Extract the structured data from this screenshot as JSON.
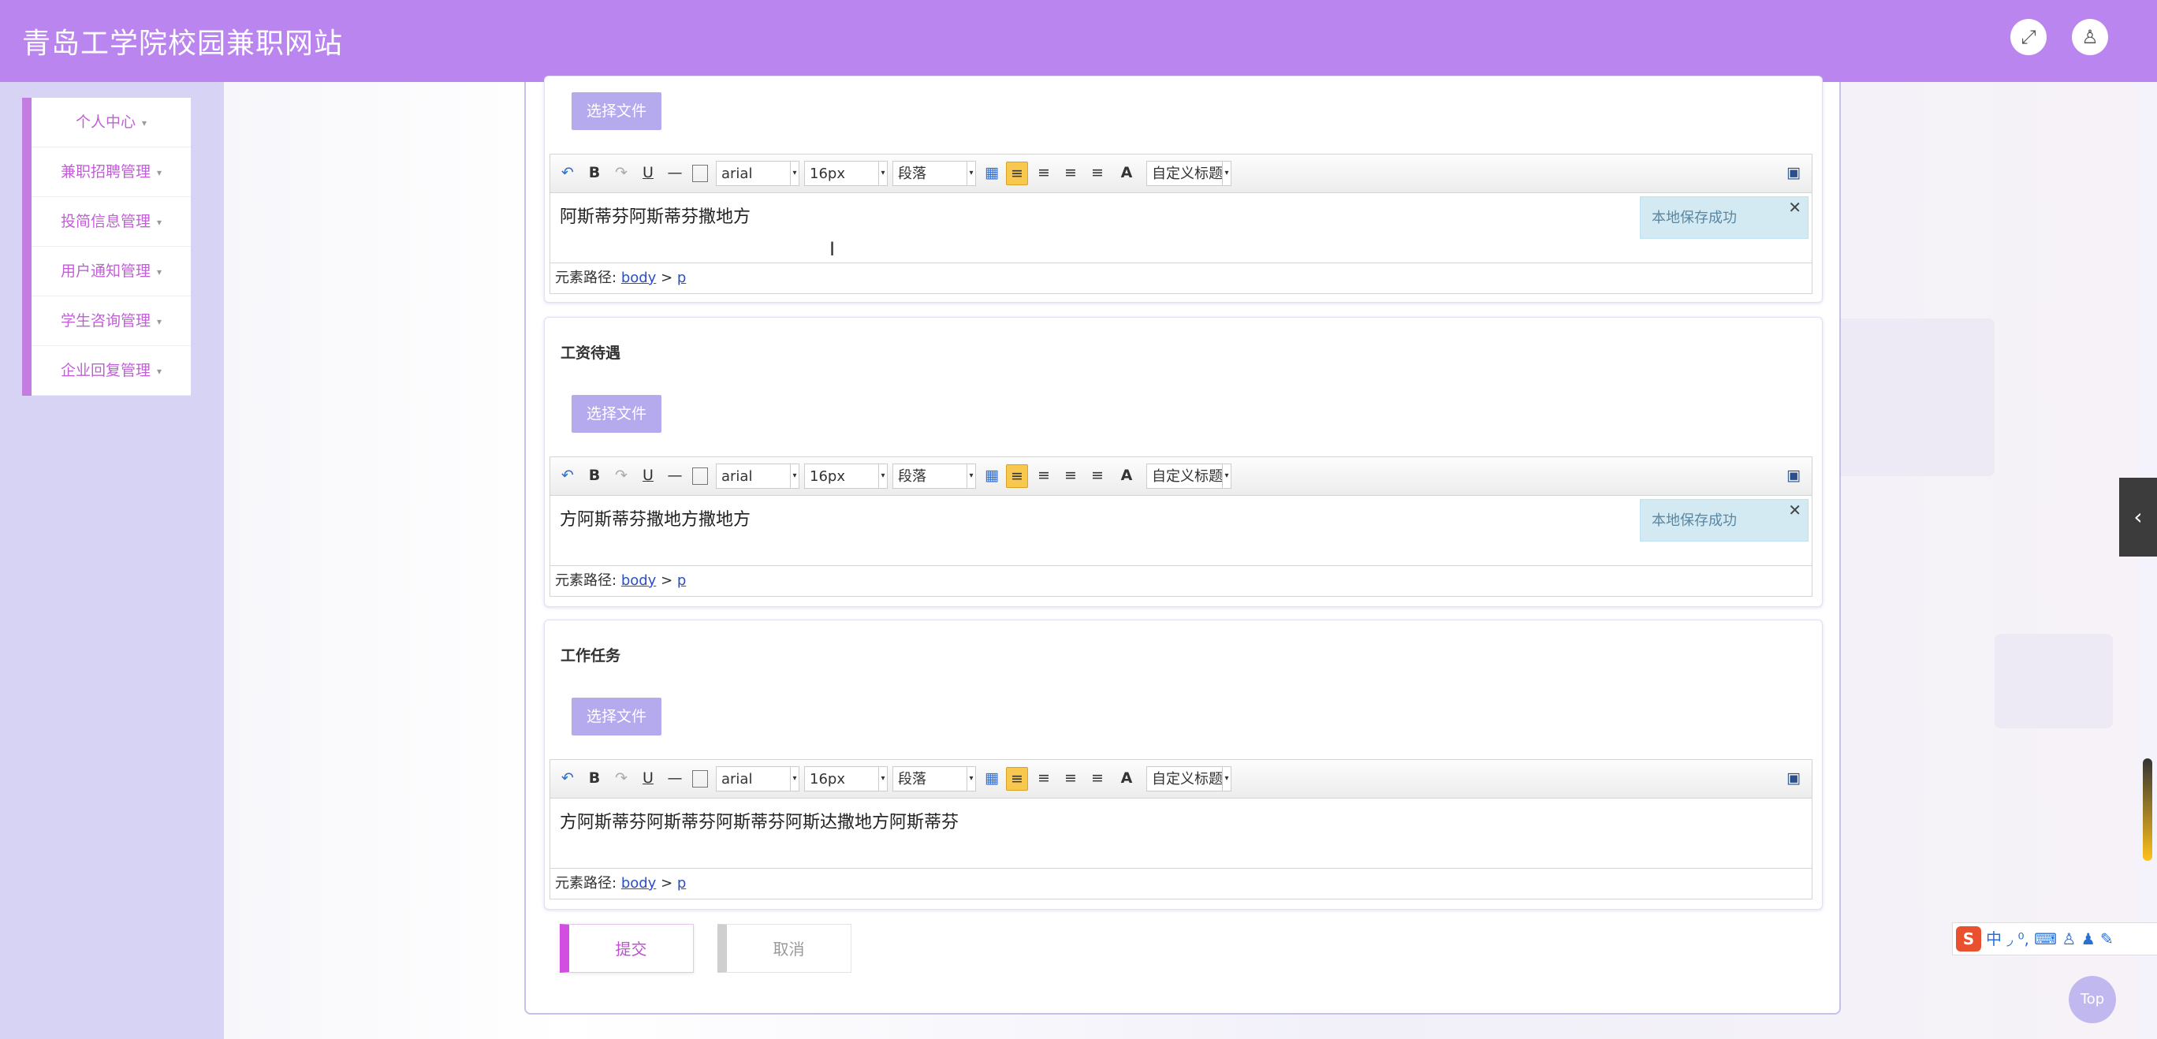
{
  "header": {
    "title": "青岛工学院校园兼职网站",
    "fullscreen_icon": "⤢",
    "user_icon": "♙"
  },
  "sidebar": {
    "items": [
      {
        "label": "个人中心"
      },
      {
        "label": "兼职招聘管理"
      },
      {
        "label": "投简信息管理"
      },
      {
        "label": "用户通知管理"
      },
      {
        "label": "学生咨询管理"
      },
      {
        "label": "企业回复管理"
      }
    ]
  },
  "editor_toolbar": {
    "undo": "↶",
    "bold": "B",
    "redo": "↷",
    "underline": "U",
    "hr": "—",
    "font": "arial",
    "size": "16px",
    "paragraph": "段落",
    "font_color": "A",
    "custom_title": "自定义标题",
    "html_icon": "▣"
  },
  "sections": [
    {
      "label": "",
      "file_button": "选择文件",
      "content": "阿斯蒂芬阿斯蒂芬撒地方",
      "saved": "本地保存成功",
      "close": "✕",
      "path_label": "元素路径:",
      "path_body": "body",
      "path_sep": ">",
      "path_p": "p"
    },
    {
      "label": "工资待遇",
      "file_button": "选择文件",
      "content": "方阿斯蒂芬撒地方撒地方",
      "saved": "本地保存成功",
      "close": "✕",
      "path_label": "元素路径:",
      "path_body": "body",
      "path_sep": ">",
      "path_p": "p"
    },
    {
      "label": "工作任务",
      "file_button": "选择文件",
      "content": "方阿斯蒂芬阿斯蒂芬阿斯蒂芬阿斯达撒地方阿斯蒂芬",
      "saved": "",
      "close": "",
      "path_label": "元素路径:",
      "path_body": "body",
      "path_sep": ">",
      "path_p": "p"
    }
  ],
  "actions": {
    "submit": "提交",
    "cancel": "取消"
  },
  "widgets": {
    "top": "Top",
    "side_tab": "‹",
    "ime_logo": "S",
    "ime_tools": "中 ◞ ⁰, ⌨ ♙ ♟ ✎"
  }
}
